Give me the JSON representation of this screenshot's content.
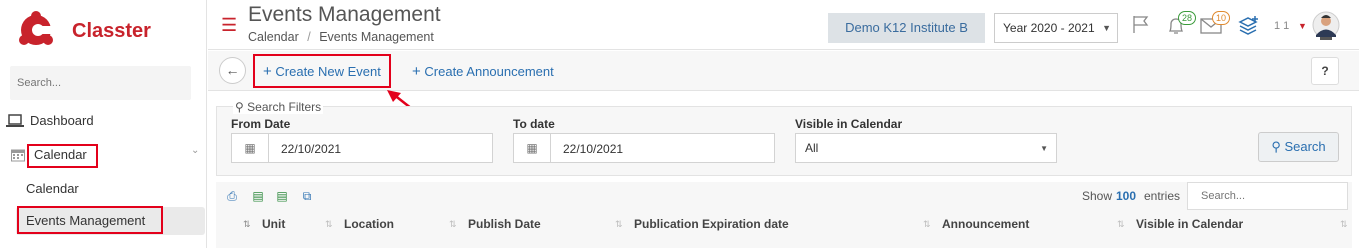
{
  "sidebar": {
    "brand": "Classter",
    "search_placeholder": "Search...",
    "items": [
      {
        "label": "Dashboard",
        "icon": "laptop-icon"
      },
      {
        "label": "Calendar",
        "icon": "calendar-icon"
      }
    ],
    "sub_items": [
      {
        "label": "Calendar"
      },
      {
        "label": "Events Management"
      }
    ]
  },
  "header": {
    "title": "Events Management",
    "breadcrumb": [
      "Calendar",
      "Events Management"
    ],
    "breadcrumb_sep": "/",
    "institute": "Demo K12 Institute B",
    "year": "Year 2020 - 2021",
    "badges": {
      "notifications": "28",
      "messages": "10"
    },
    "user_num": "1 1"
  },
  "toolbar": {
    "create_event": "Create New Event",
    "create_announcement": "Create Announcement",
    "help": "?"
  },
  "filters": {
    "legend": "Search Filters",
    "from_label": "From Date",
    "from_value": "22/10/2021",
    "to_label": "To date",
    "to_value": "22/10/2021",
    "visible_label": "Visible in Calendar",
    "visible_value": "All",
    "search_label": "Search"
  },
  "table": {
    "show_prefix": "Show",
    "show_count": "100",
    "show_suffix": "entries",
    "search_placeholder": "Search...",
    "columns": [
      "Unit",
      "Location",
      "Publish Date",
      "Publication Expiration date",
      "Announcement",
      "Visible in Calendar"
    ]
  },
  "colors": {
    "brand_red": "#c8232c",
    "link_blue": "#2a6fb0",
    "highlight_red": "#e3001b"
  }
}
